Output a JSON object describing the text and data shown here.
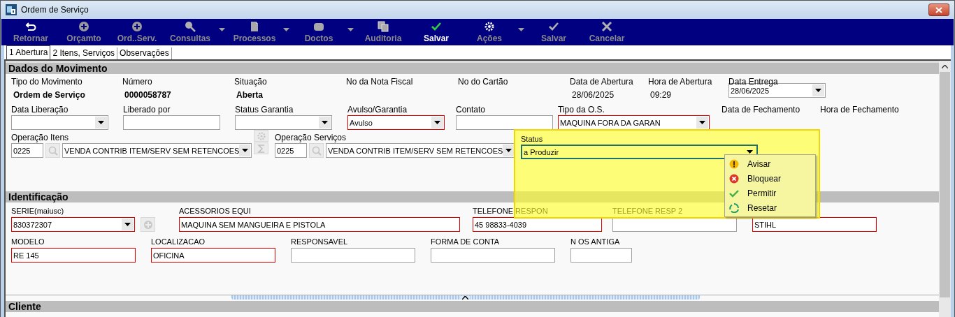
{
  "window": {
    "title": "Ordem de Serviço"
  },
  "toolbar": [
    {
      "label": "Retornar",
      "enabled": false,
      "has_menu": false
    },
    {
      "label": "Orçamto",
      "enabled": false,
      "has_menu": false
    },
    {
      "label": "Ord..Serv.",
      "enabled": false,
      "has_menu": false
    },
    {
      "label": "Consultas",
      "enabled": false,
      "has_menu": true
    },
    {
      "label": "Processos",
      "enabled": false,
      "has_menu": true
    },
    {
      "label": "Doctos",
      "enabled": false,
      "has_menu": true
    },
    {
      "label": "Auditoria",
      "enabled": false,
      "has_menu": false
    },
    {
      "label": "Salvar",
      "enabled": true,
      "has_menu": false
    },
    {
      "label": "Ações",
      "enabled": false,
      "has_menu": true
    },
    {
      "label": "Salvar",
      "enabled": false,
      "has_menu": false
    },
    {
      "label": "Cancelar",
      "enabled": false,
      "has_menu": false
    }
  ],
  "tabs": [
    {
      "label": "1 Abertura",
      "selected": true
    },
    {
      "label": "2 Itens, Serviços",
      "selected": false
    },
    {
      "label": "Observações",
      "selected": false
    }
  ],
  "movimento": {
    "title": "Dados do Movimento",
    "rows": [
      {
        "fields": [
          {
            "kind": "display",
            "label": "Tipo do Movimento",
            "value": "Ordem de Serviço",
            "bold": true
          },
          {
            "kind": "display",
            "label": "Número",
            "value": "0000058787",
            "bold": true
          },
          {
            "kind": "display",
            "label": "Situação",
            "value": "Aberta",
            "bold": true
          },
          {
            "kind": "display",
            "label": "No da Nota Fiscal"
          },
          {
            "kind": "display",
            "label": "No do Cartão"
          },
          {
            "kind": "display",
            "label": "Data de Abertura",
            "value": "28/06/2025",
            "bold": false
          },
          {
            "kind": "display",
            "label": "Hora de Abertura",
            "value": "09:29",
            "bold": false
          },
          {
            "kind": "combo",
            "label": "Data Entrega",
            "value": "28/06/2025",
            "required": false
          }
        ]
      },
      {
        "fields": [
          {
            "kind": "combo",
            "label": "Data Liberação",
            "required": false
          },
          {
            "kind": "text",
            "label": "Liberado por",
            "required": false
          },
          {
            "kind": "combo",
            "label": "Status Garantia",
            "required": false
          },
          {
            "kind": "combo",
            "label": "Avulso/Garantia",
            "value": "Avulso",
            "required": true
          },
          {
            "kind": "text",
            "label": "Contato",
            "required": false
          },
          {
            "kind": "combo",
            "label": "Tipo da O.S.",
            "value": "MAQUINA FORA DA GARAN",
            "required": true
          },
          {
            "kind": "display",
            "label": "Data de Fechamento"
          },
          {
            "kind": "display",
            "label": "Hora de Fechamento"
          }
        ]
      },
      {
        "fields": [
          {
            "kind": "lookup",
            "label": "Operação Itens",
            "code": "0225",
            "value": "VENDA CONTRIB ITEM/SERV SEM RETENCOES"
          },
          {
            "kind": "tools"
          },
          {
            "kind": "lookup",
            "label": "Operação Serviços",
            "code": "0225",
            "value": "VENDA CONTRIB ITEM/SERV SEM RETENCOES"
          }
        ]
      }
    ]
  },
  "status_panel": {
    "label": "Status",
    "value": "a Produzir",
    "menu": [
      {
        "label": "Avisar"
      },
      {
        "label": "Bloquear"
      },
      {
        "label": "Permitir"
      },
      {
        "label": "Resetar"
      }
    ]
  },
  "identificacao": {
    "title": "Identificação",
    "rows": [
      {
        "fields": [
          {
            "kind": "combo_add",
            "label": "SERIE(maiusc)",
            "value": "830372307",
            "required": true
          },
          {
            "kind": "text",
            "label": "ACESSORIOS EQUI",
            "value": "MAQUINA SEM MANGUEIRA E PISTOLA",
            "required": true
          },
          {
            "kind": "text",
            "label": "TELEFONE RESPON",
            "value": "45 98833-4039",
            "required": true
          },
          {
            "kind": "text",
            "label": "TELEFONE RESP 2",
            "required": false
          },
          {
            "kind": "text",
            "value": "STIHL",
            "required": true
          }
        ]
      },
      {
        "fields": [
          {
            "kind": "text",
            "label": "MODELO",
            "value": "RE 145",
            "required": true
          },
          {
            "kind": "text",
            "label": "LOCALIZACAO",
            "value": "OFICINA",
            "required": true
          },
          {
            "kind": "text",
            "label": "RESPONSAVEL",
            "required": false
          },
          {
            "kind": "text",
            "label": "FORMA DE CONTA",
            "required": false
          },
          {
            "kind": "text",
            "label": "N OS ANTIGA",
            "required": false
          }
        ]
      }
    ]
  },
  "cliente": {
    "title": "Cliente"
  }
}
